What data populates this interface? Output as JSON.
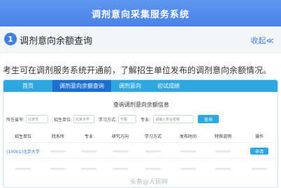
{
  "header": {
    "title": "调剂意向采集服务系统"
  },
  "section": {
    "number": "1",
    "title": "调剂意向余额查询",
    "collapse_label": "收起≪"
  },
  "intro": "考生可在调剂服务系统开通前，了解招生单位发布的调剂意向余额情况。",
  "tabs": [
    "首页",
    "调剂意向余额查询",
    "调剂意向",
    "初试成绩"
  ],
  "query": {
    "title": "查询调剂意向余额信息",
    "filters": {
      "province_label": "所在省市:",
      "province_value": "北京市",
      "unit_label": "招生单位:",
      "unit_value": "北京大学",
      "mode_label": "学习方式:",
      "mode_value": "不限",
      "major_label": "专业:",
      "major_placeholder": "请输入专业名称"
    },
    "search_label": "查询"
  },
  "table": {
    "headers": [
      "招生单位",
      "院系所",
      "专业",
      "研究方向",
      "学习方式",
      "发布时间",
      "特殊说明",
      "操作"
    ],
    "rows": [
      {
        "unit": "(10001)北京大学",
        "action": "申请"
      },
      {
        "unit": "",
        "action": ""
      }
    ]
  },
  "watermark": "头条@人民网",
  "colors": {
    "header_bg": "#4a82e8",
    "tab_bg": "#2ea7e0",
    "tab_active": "#1d6fd1",
    "accent": "#3f7fe6"
  }
}
